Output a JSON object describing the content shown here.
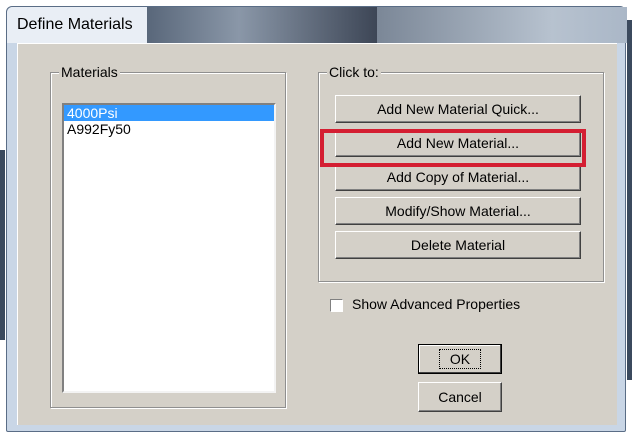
{
  "window": {
    "title": "Define Materials"
  },
  "materials_group": {
    "label": "Materials",
    "items": [
      {
        "label": "4000Psi",
        "selected": true
      },
      {
        "label": "A992Fy50",
        "selected": false
      }
    ]
  },
  "click_group": {
    "label": "Click to:",
    "buttons": {
      "add_quick": "Add New Material Quick...",
      "add_new": "Add New Material...",
      "add_copy": "Add Copy of Material...",
      "modify": "Modify/Show Material...",
      "delete": "Delete Material"
    }
  },
  "show_advanced": {
    "label": "Show Advanced Properties",
    "checked": false
  },
  "actions": {
    "ok": "OK",
    "cancel": "Cancel"
  },
  "colors": {
    "selection": "#3399ff",
    "highlight_box": "#d41e32",
    "dialog_face": "#d4d0c8"
  }
}
